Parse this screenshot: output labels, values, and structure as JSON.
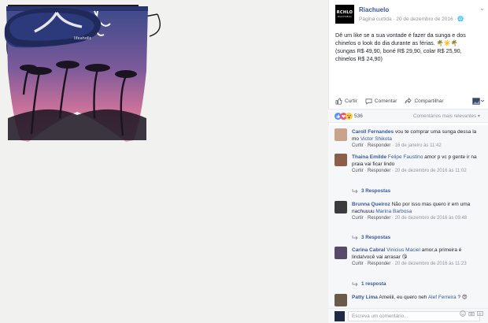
{
  "post": {
    "page_name": "Riachuelo",
    "avatar_text": "RCHLO",
    "avatar_subtext": "RIACHUELO",
    "meta": "Página curtida · 20 de dezembro de 2016 · 🌐",
    "text_line1": "Dê um like se a sua vontade é fazer da sunga e dos",
    "text_line2": "chinelos o look do dia durante as férias. 🌴☀️🌴",
    "text_line3": "(sungas R$ 49,90, boné R$ 29,90, colar R$ 25,90,",
    "text_line4": "chinelos R$ 24,90)",
    "menu_icon": "chevron-down-icon"
  },
  "actions": {
    "like": "Curtir",
    "comment": "Comentar",
    "share": "Compartilhar"
  },
  "reactions": {
    "count": "536",
    "sort_label": "Comentários mais relevantes ▾"
  },
  "comments": [
    {
      "author": "Caroll Fernandes",
      "text": " vou te comprar uma sunga dessa la mo",
      "tag": " Victor Shikota",
      "meta_like": "Curtir",
      "meta_reply": "Responder",
      "meta_time": "16 de janeiro às 11:42",
      "avatar_color": "#c9a48a"
    },
    {
      "author": "Thaina Emilde",
      "text": "",
      "tag": " Felipe Faustino",
      "text_after": " amor p vc p gente ir na praia vai ficar lindo",
      "meta_like": "Curtir",
      "meta_reply": "Responder",
      "meta_time": "20 de dezembro de 2016 às 11:02",
      "avatar_color": "#8b5e4a",
      "replies": "3 Respostas"
    },
    {
      "author": "Brunna Queiroz",
      "text": " Não por isso mas quero ir em uma nachuuuu",
      "tag": " Marina Barbosa",
      "meta_like": "Curtir",
      "meta_reply": "Responder",
      "meta_time": "20 de dezembro de 2016 às 09:48",
      "avatar_color": "#3b3b3b",
      "replies": "3 Respostas"
    },
    {
      "author": "Carina Cabral",
      "text": "",
      "tag": " Vinicius Maciel",
      "text_after": " amor,a primeira é linda!você vai arrasar 😘",
      "meta_like": "Curtir",
      "meta_reply": "Responder",
      "meta_time": "20 de dezembro de 2016 às 11:23",
      "avatar_color": "#5a4a6a",
      "replies": "1 resposta"
    },
    {
      "author": "Patty Lima",
      "text": " Ameiiii, eu quero neh",
      "tag": " Alef Ferreira",
      "text_after": " ? 😍",
      "avatar_color": "#6a5a4a"
    }
  ],
  "composer": {
    "placeholder": "Escreva um comentário..."
  }
}
